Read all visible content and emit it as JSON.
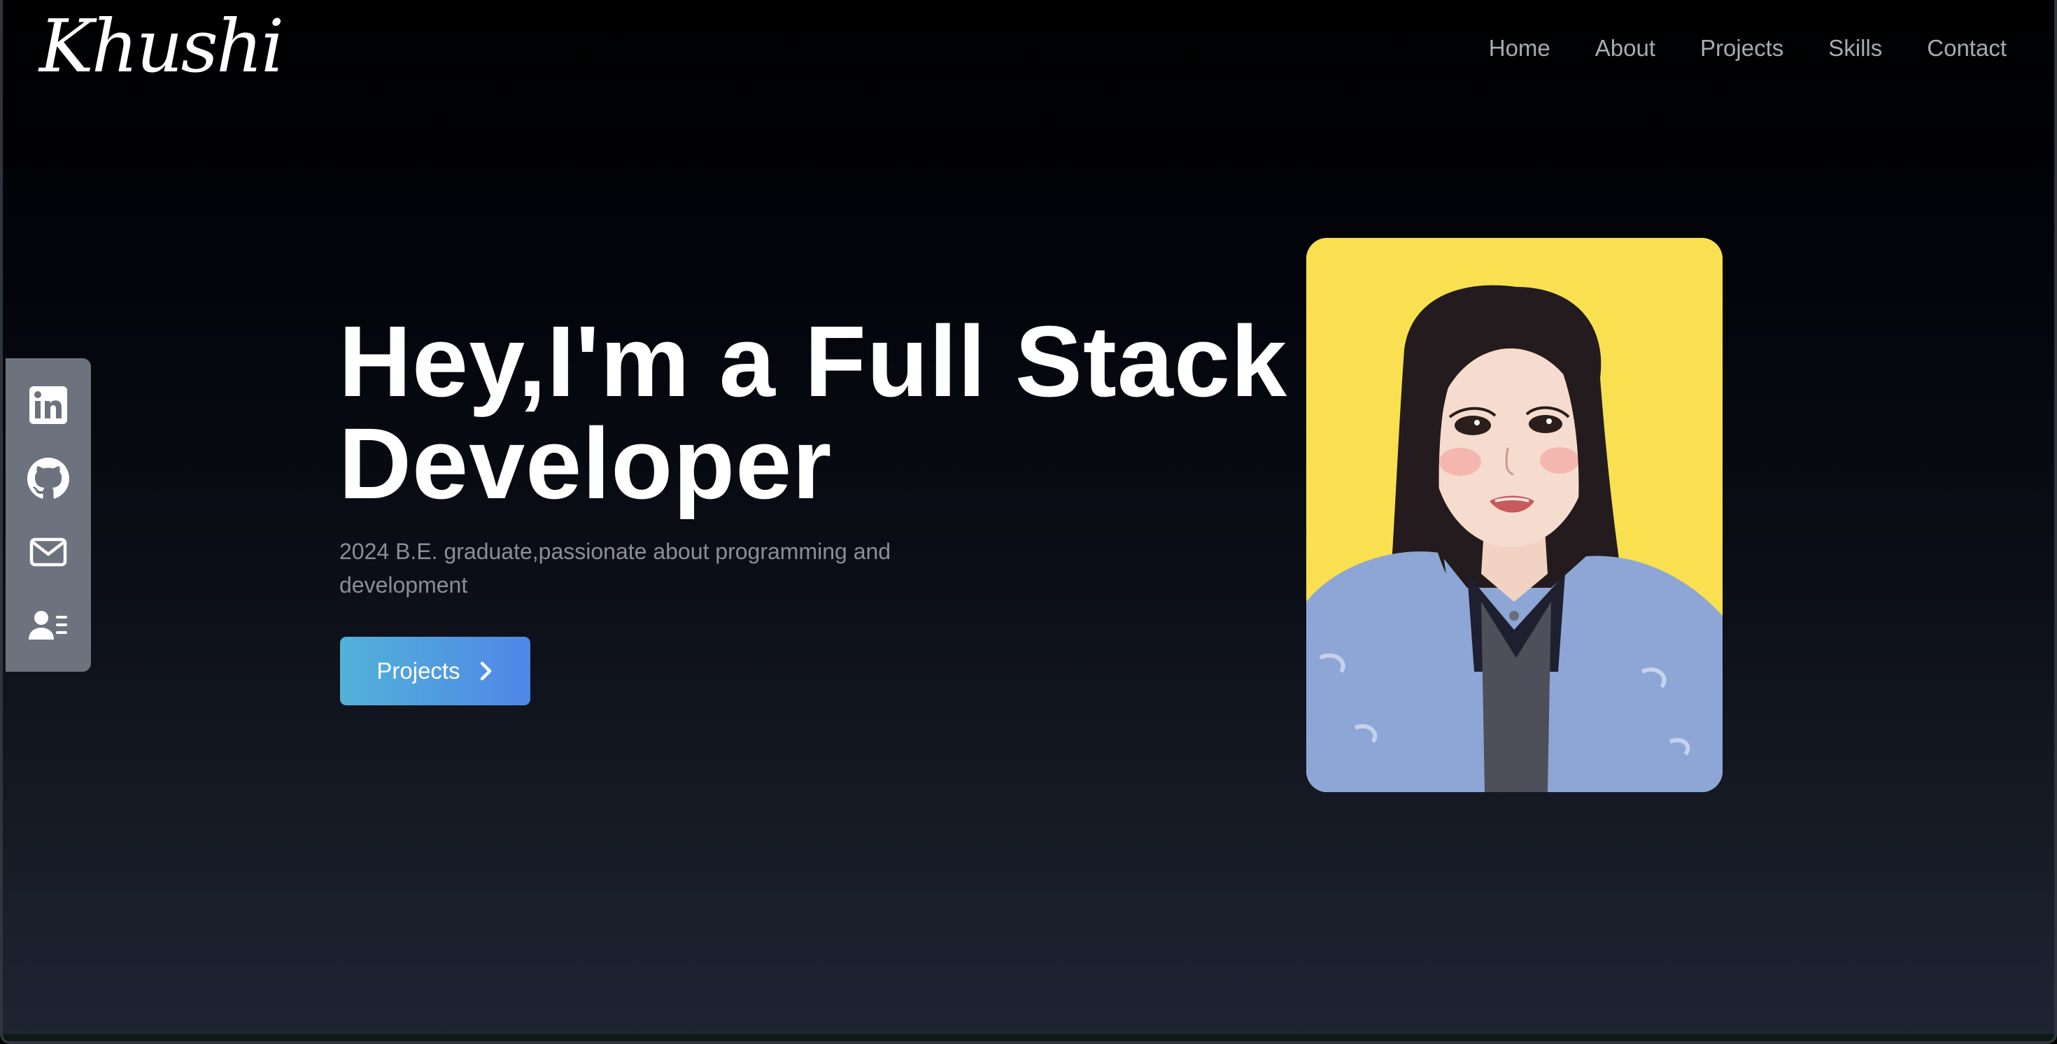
{
  "header": {
    "logo_text": "Khushi",
    "nav": [
      {
        "label": "Home"
      },
      {
        "label": "About"
      },
      {
        "label": "Projects"
      },
      {
        "label": "Skills"
      },
      {
        "label": "Contact"
      }
    ]
  },
  "social": [
    {
      "icon": "linkedin-icon"
    },
    {
      "icon": "github-icon"
    },
    {
      "icon": "mail-icon"
    },
    {
      "icon": "resume-icon"
    }
  ],
  "hero": {
    "title_line1": "Hey,I'm a Full Stack",
    "title_line2": "Developer",
    "subtitle": "2024 B.E. graduate,passionate about programming and development",
    "button_label": "Projects",
    "button_icon": "chevron-right-icon"
  },
  "portrait": {
    "icon": "profile-illustration",
    "background_color": "#f9e050"
  },
  "colors": {
    "accent_gradient_start": "#52b2d8",
    "accent_gradient_end": "#4f86e8",
    "nav_text": "#a7abb3",
    "social_bar": "#6c737e",
    "subtitle_text": "#8a8e96"
  }
}
